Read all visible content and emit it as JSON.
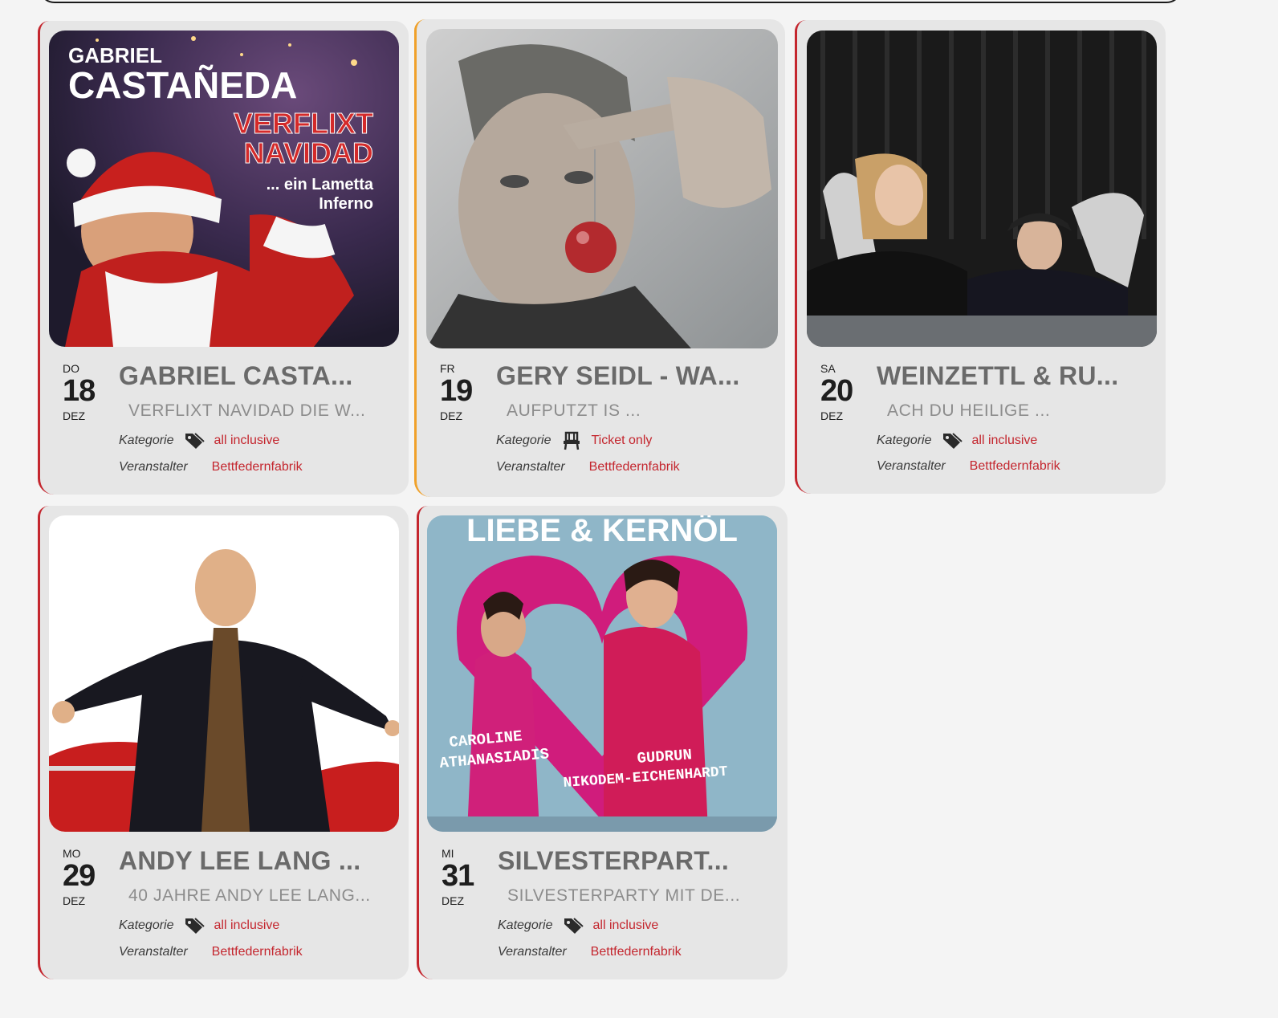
{
  "colors": {
    "accent_red": "#c4262e",
    "accent_orange": "#f0a12a",
    "card_bg": "#e6e6e6",
    "page_bg": "#f4f4f4"
  },
  "labels": {
    "category": "Kategorie",
    "organizer": "Veranstalter"
  },
  "events": [
    {
      "dow": "DO",
      "day": "18",
      "month": "DEZ",
      "title": "GABRIEL CASTA...",
      "subtitle": "VERFLIXT NAVIDAD DIE W...",
      "category": "all inclusive",
      "category_icon": "tag-icon",
      "organizer": "Bettfedernfabrik",
      "accent": "red",
      "poster": {
        "line1": "GABRIEL",
        "line2": "CASTAÑEDA",
        "line3": "VERFLIXT",
        "line4": "NAVIDAD",
        "line5": "... ein Lametta",
        "line6": "Inferno"
      }
    },
    {
      "dow": "FR",
      "day": "19",
      "month": "DEZ",
      "title": "GERY SEIDL - WA...",
      "subtitle": "AUFPUTZT IS ...",
      "category": "Ticket only",
      "category_icon": "seat-icon",
      "organizer": "Bettfedernfabrik",
      "accent": "orange"
    },
    {
      "dow": "SA",
      "day": "20",
      "month": "DEZ",
      "title": "WEINZETTL & RU...",
      "subtitle": "ACH DU HEILIGE ...",
      "category": "all inclusive",
      "category_icon": "tag-icon",
      "organizer": "Bettfedernfabrik",
      "accent": "red"
    },
    {
      "dow": "MO",
      "day": "29",
      "month": "DEZ",
      "title": "ANDY LEE LANG ...",
      "subtitle": "40 JAHRE ANDY LEE LANG...",
      "category": "all inclusive",
      "category_icon": "tag-icon",
      "organizer": "Bettfedernfabrik",
      "accent": "red"
    },
    {
      "dow": "MI",
      "day": "31",
      "month": "DEZ",
      "title": "SILVESTERPART...",
      "subtitle": "SILVESTERPARTY MIT DE...",
      "category": "all inclusive",
      "category_icon": "tag-icon",
      "organizer": "Bettfedernfabrik",
      "accent": "red",
      "poster": {
        "headline": "LIEBE & KERNÖL",
        "name1a": "CAROLINE",
        "name1b": "ATHANASIADIS",
        "name2a": "GUDRUN",
        "name2b": "NIKODEM-EICHENHARDT"
      }
    }
  ]
}
